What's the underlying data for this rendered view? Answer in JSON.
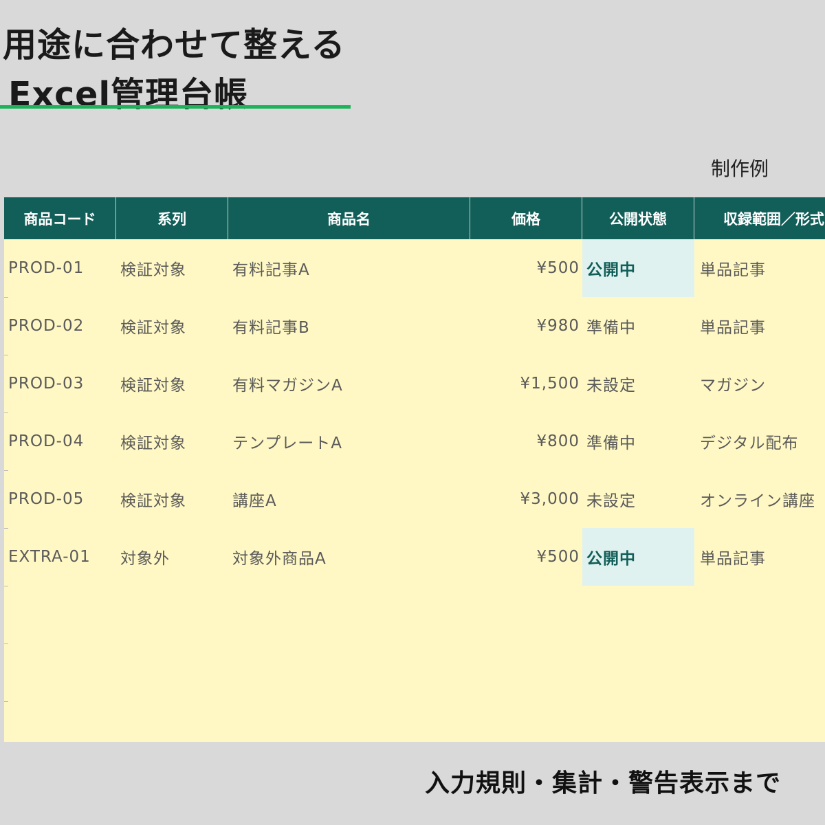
{
  "title": {
    "line1": "用途に合わせて整える",
    "line2": "Excel管理台帳"
  },
  "sample_label": "制作例",
  "table": {
    "columns": [
      "商品コード",
      "系列",
      "商品名",
      "価格",
      "公開状態",
      "収録範囲／形式"
    ],
    "rows": [
      {
        "code": "PROD-01",
        "series": "検証対象",
        "name": "有料記事A",
        "price": "¥500",
        "status": "公開中",
        "published": true,
        "scope": "単品記事"
      },
      {
        "code": "PROD-02",
        "series": "検証対象",
        "name": "有料記事B",
        "price": "¥980",
        "status": "準備中",
        "published": false,
        "scope": "単品記事"
      },
      {
        "code": "PROD-03",
        "series": "検証対象",
        "name": "有料マガジンA",
        "price": "¥1,500",
        "status": "未設定",
        "published": false,
        "scope": "マガジン"
      },
      {
        "code": "PROD-04",
        "series": "検証対象",
        "name": "テンプレートA",
        "price": "¥800",
        "status": "準備中",
        "published": false,
        "scope": "デジタル配布"
      },
      {
        "code": "PROD-05",
        "series": "検証対象",
        "name": "講座A",
        "price": "¥3,000",
        "status": "未設定",
        "published": false,
        "scope": "オンライン講座"
      },
      {
        "code": "EXTRA-01",
        "series": "対象外",
        "name": "対象外商品A",
        "price": "¥500",
        "status": "公開中",
        "published": true,
        "scope": "単品記事"
      }
    ]
  },
  "footer_caption": "入力規則・集計・警告表示まで",
  "colors": {
    "header_bg": "#125e59",
    "sheet_bg": "#fff8c4",
    "published_bg": "#dff2ef",
    "accent_underline": "#1db35a"
  }
}
